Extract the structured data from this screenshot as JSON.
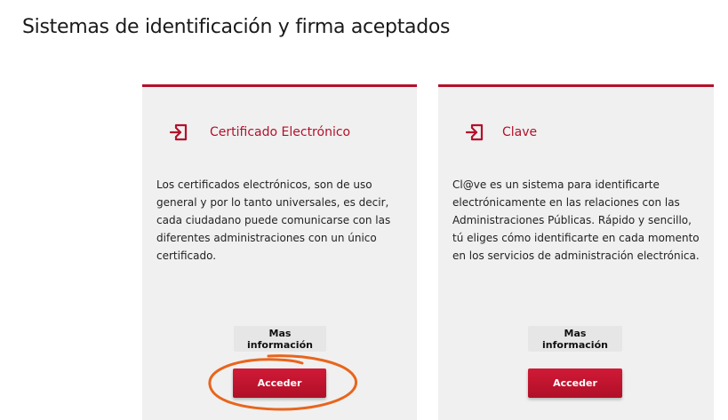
{
  "page": {
    "title": "Sistemas de identificación y firma aceptados"
  },
  "cards": [
    {
      "title": "Certificado Electrónico",
      "icon": "login-icon",
      "description": "Los certificados electrónicos, son de uso general y por lo tanto universales, es decir, cada ciudadano puede comunicarse con las diferentes administraciones con un único certificado.",
      "more_label": "Mas información",
      "access_label": "Acceder"
    },
    {
      "title": "Clave",
      "icon": "login-icon",
      "description": "Cl@ve es un sistema para identificarte electrónicamente en las relaciones con las Administraciones Públicas. Rápido y sencillo, tú eliges cómo identificarte en cada momento en los servicios de administración electrónica.",
      "more_label": "Mas información",
      "access_label": "Acceder"
    }
  ],
  "colors": {
    "brand_red": "#b3112a",
    "card_bg": "#f0f0f0",
    "secondary_button_bg": "#e6e6e6",
    "annotation": "#e8651c"
  }
}
